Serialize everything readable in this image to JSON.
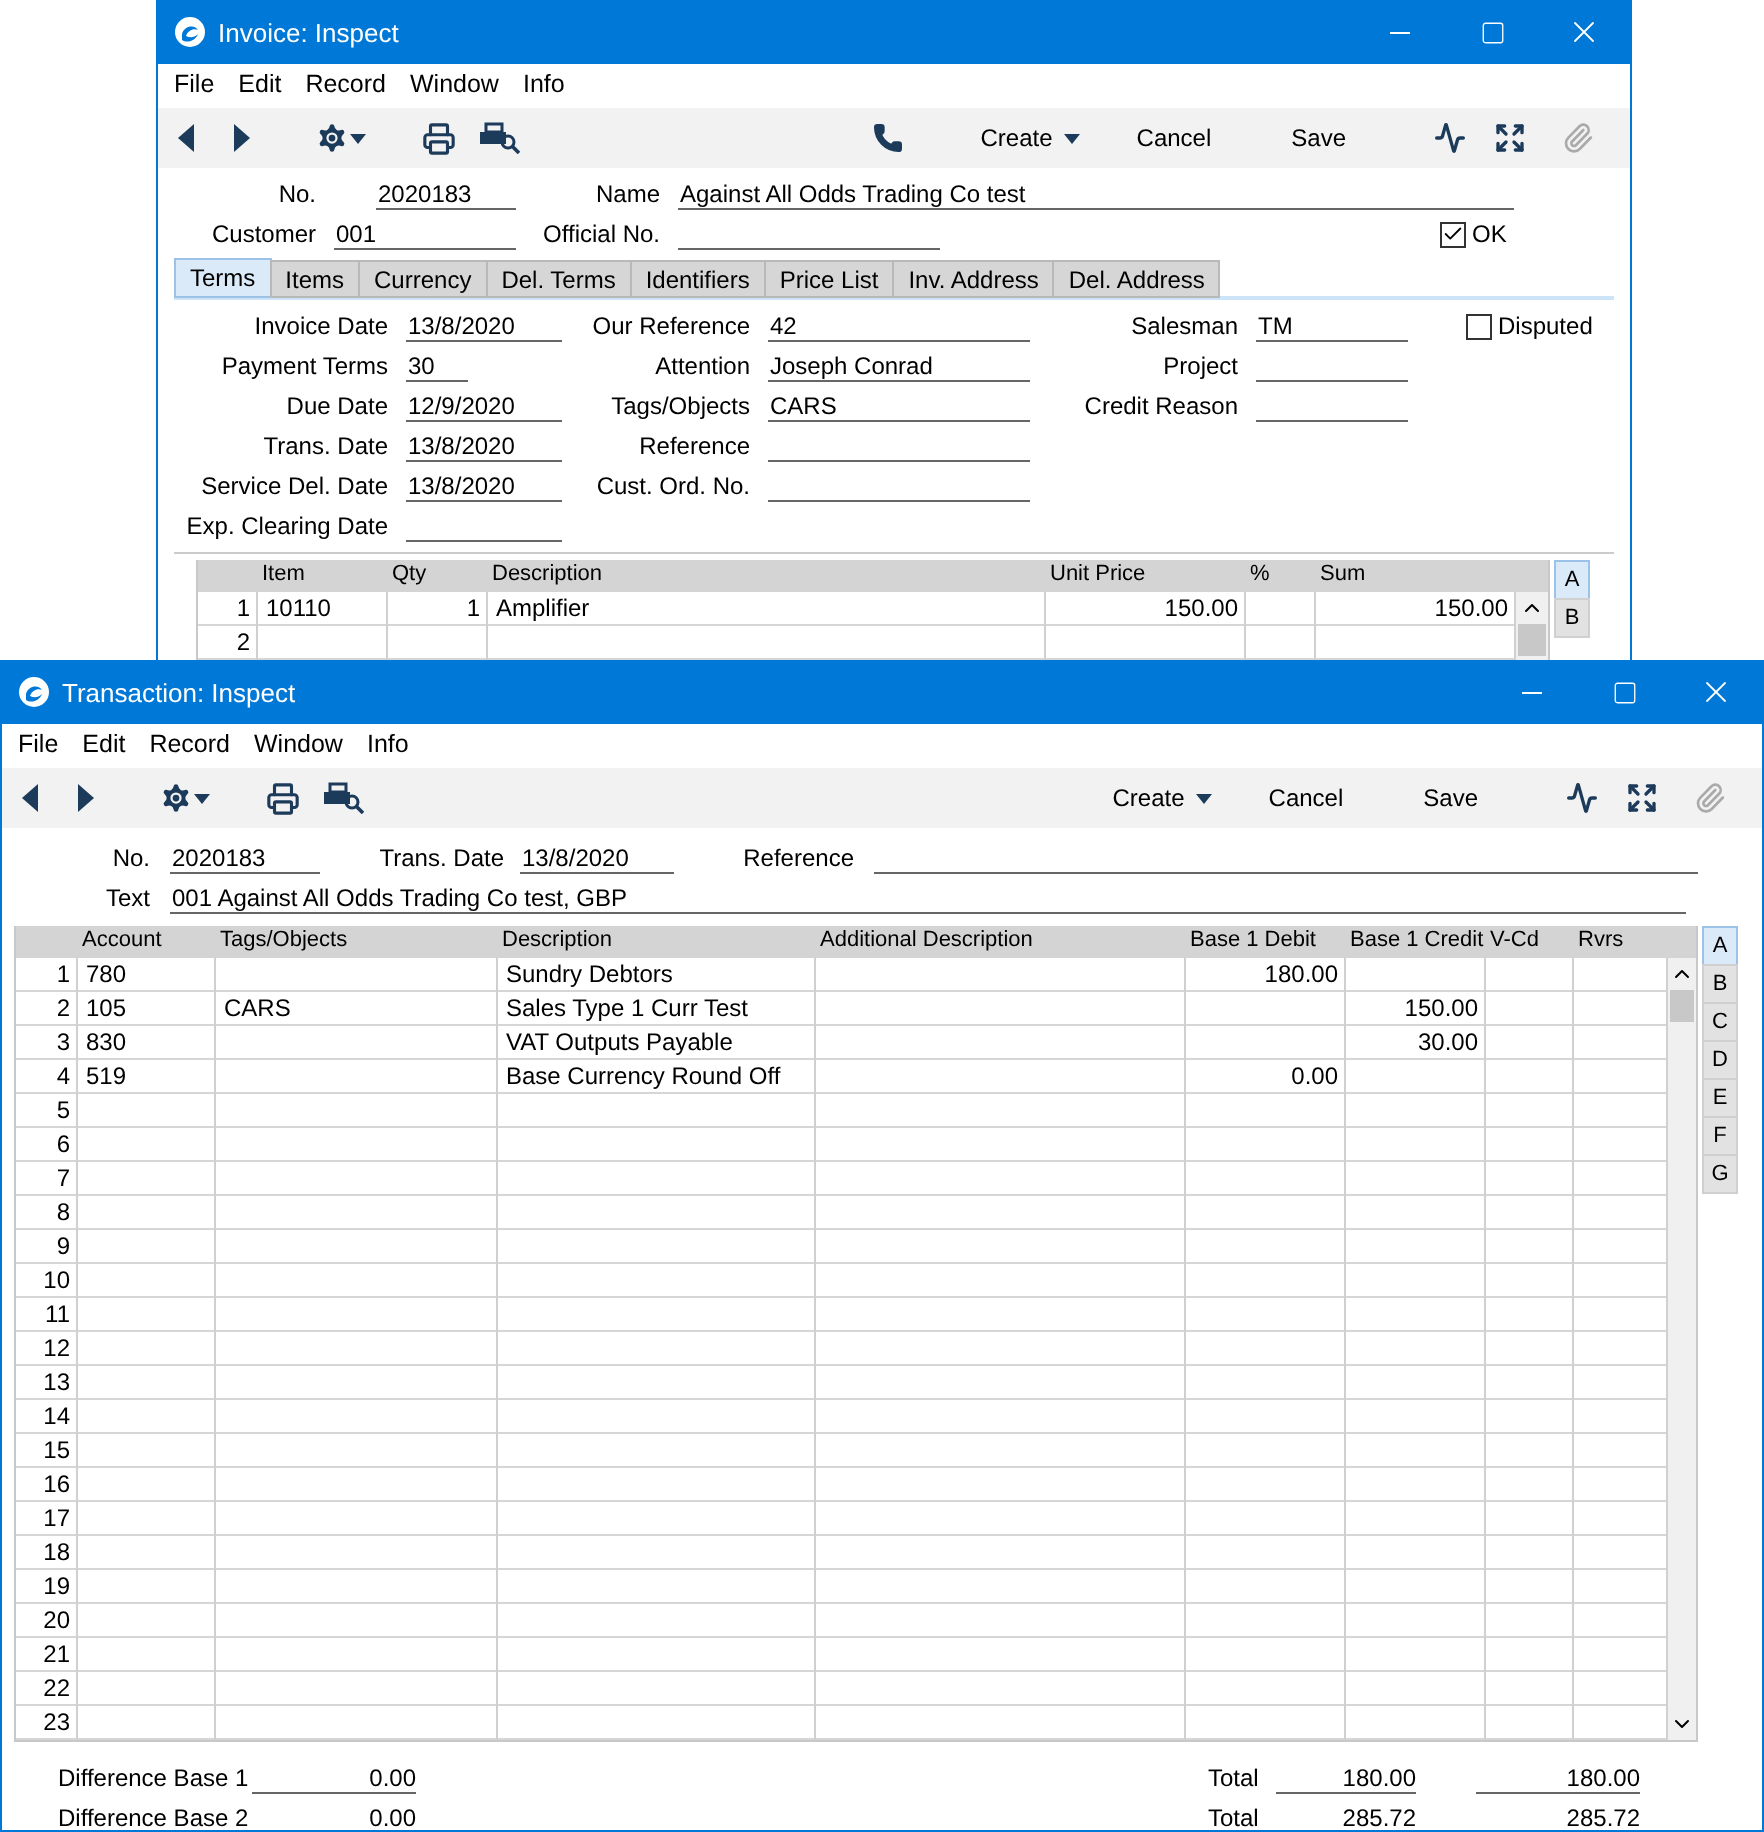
{
  "invoice_window": {
    "title": "Invoice: Inspect",
    "menu": [
      "File",
      "Edit",
      "Record",
      "Window",
      "Info"
    ],
    "toolbar": {
      "create": "Create",
      "cancel": "Cancel",
      "save": "Save"
    },
    "header_rows": [
      [
        {
          "label": "No.",
          "value": "2020183"
        },
        {
          "label": "Name",
          "value": "Against All Odds Trading Co test"
        }
      ],
      [
        {
          "label": "Customer",
          "value": "001"
        },
        {
          "label": "Official No."
        }
      ]
    ],
    "ok": {
      "label": "OK",
      "checked": true
    },
    "tabs": [
      {
        "label": "Terms",
        "selected": true
      },
      {
        "label": "Items",
        "selected": false
      },
      {
        "label": "Currency",
        "selected": false
      },
      {
        "label": "Del. Terms",
        "selected": false
      },
      {
        "label": "Identifiers",
        "selected": false
      },
      {
        "label": "Price List",
        "selected": false
      },
      {
        "label": "Inv. Address",
        "selected": false
      },
      {
        "label": "Del. Address",
        "selected": false
      }
    ],
    "terms_columns": [
      [
        {
          "label": "Invoice Date",
          "value": "13/8/2020"
        },
        {
          "label": "Payment Terms",
          "value": "30"
        },
        {
          "label": "Due Date",
          "value": "12/9/2020"
        },
        {
          "label": "Trans. Date",
          "value": "13/8/2020"
        },
        {
          "label": "Service Del. Date",
          "value": "13/8/2020"
        },
        {
          "label": "Exp. Clearing Date"
        }
      ],
      [
        {
          "label": "Our Reference",
          "value": "42"
        },
        {
          "label": "Attention",
          "value": "Joseph Conrad"
        },
        {
          "label": "Tags/Objects",
          "value": "CARS"
        },
        {
          "label": "Reference"
        },
        {
          "label": "Cust. Ord. No."
        }
      ],
      [
        {
          "label": "Salesman",
          "value": "TM"
        },
        {
          "label": "Project"
        },
        {
          "label": "Credit Reason"
        }
      ]
    ],
    "disputed": {
      "label": "Disputed",
      "checked": false
    },
    "items_table": {
      "columns": [
        "Item",
        "Qty",
        "Description",
        "Unit Price",
        "%",
        "Sum"
      ],
      "rows": [
        {
          "number": "1",
          "cells": [
            "10110",
            "1",
            "Amplifier",
            "150.00",
            null,
            "150.00"
          ]
        },
        {
          "number": "2"
        }
      ]
    },
    "side_tabs": [
      {
        "label": "A",
        "selected": true
      },
      {
        "label": "B",
        "selected": false
      }
    ]
  },
  "transaction_window": {
    "title": "Transaction: Inspect",
    "menu": [
      "File",
      "Edit",
      "Record",
      "Window",
      "Info"
    ],
    "toolbar": {
      "create": "Create",
      "cancel": "Cancel",
      "save": "Save"
    },
    "fields": {
      "no": {
        "label": "No.",
        "value": "2020183"
      },
      "trans_date": {
        "label": "Trans. Date",
        "value": "13/8/2020"
      },
      "reference": {
        "label": "Reference"
      },
      "text": {
        "label": "Text",
        "value": "001 Against All Odds Trading Co test, GBP"
      }
    },
    "table": {
      "columns": [
        "Account",
        "Tags/Objects",
        "Description",
        "Additional Description",
        "Base 1 Debit",
        "Base 1 Credit",
        "V-Cd",
        "Rvrs"
      ],
      "rows": [
        {
          "number": "1",
          "cells": [
            "780",
            null,
            "Sundry Debtors",
            null,
            "180.00",
            null,
            null,
            null
          ]
        },
        {
          "number": "2",
          "cells": [
            "105",
            "CARS",
            "Sales Type 1 Curr Test",
            null,
            null,
            "150.00",
            null,
            null
          ]
        },
        {
          "number": "3",
          "cells": [
            "830",
            null,
            "VAT Outputs Payable",
            null,
            null,
            "30.00",
            null,
            null
          ]
        },
        {
          "number": "4",
          "cells": [
            "519",
            null,
            "Base Currency Round Off",
            null,
            "0.00",
            null,
            null,
            null
          ]
        },
        {
          "number": "5"
        },
        {
          "number": "6"
        },
        {
          "number": "7"
        },
        {
          "number": "8"
        },
        {
          "number": "9"
        },
        {
          "number": "10"
        },
        {
          "number": "11"
        },
        {
          "number": "12"
        },
        {
          "number": "13"
        },
        {
          "number": "14"
        },
        {
          "number": "15"
        },
        {
          "number": "16"
        },
        {
          "number": "17"
        },
        {
          "number": "18"
        },
        {
          "number": "19"
        },
        {
          "number": "20"
        },
        {
          "number": "21"
        },
        {
          "number": "22"
        },
        {
          "number": "23"
        }
      ]
    },
    "side_tabs": [
      {
        "label": "A",
        "selected": true
      },
      {
        "label": "B",
        "selected": false
      },
      {
        "label": "C",
        "selected": false
      },
      {
        "label": "D",
        "selected": false
      },
      {
        "label": "E",
        "selected": false
      },
      {
        "label": "F",
        "selected": false
      },
      {
        "label": "G",
        "selected": false
      }
    ],
    "footer_rows": [
      {
        "difference_label": "Difference Base 1",
        "difference": "0.00",
        "total_label": "Total",
        "debit": "180.00",
        "credit": "180.00"
      },
      {
        "difference_label": "Difference Base 2",
        "difference": "0.00",
        "total_label": "Total",
        "debit": "285.72",
        "credit": "285.72"
      }
    ]
  }
}
